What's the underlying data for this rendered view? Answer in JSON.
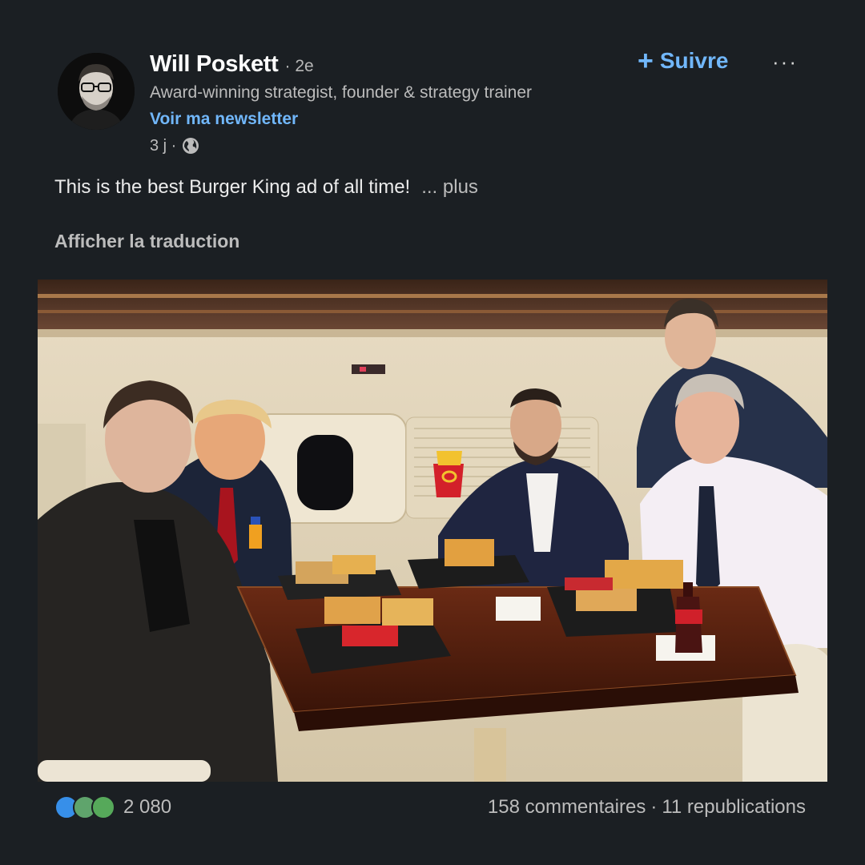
{
  "author": {
    "name": "Will Poskett",
    "degree": "· 2e",
    "headline": "Award-winning strategist, founder & strategy trainer",
    "newsletter_link": "Voir ma newsletter",
    "time": "3 j ·"
  },
  "actions": {
    "follow_label": "Suivre",
    "more_label": "···"
  },
  "post": {
    "text": "This is the best Burger King ad of all time!",
    "more_link": "... plus",
    "translate_label": "Afficher la traduction"
  },
  "engagement": {
    "reaction_count": "2 080",
    "comments": "158 commentaires",
    "separator": "·",
    "reposts": "11 republications"
  },
  "icons": {
    "follow": "plus-icon",
    "visibility": "globe-icon",
    "more": "ellipsis-icon",
    "reactions": [
      "like-icon",
      "celebrate-icon",
      "support-icon"
    ]
  },
  "colors": {
    "background": "#1b1f23",
    "link": "#71b7fb",
    "muted_text": "#bcbcbc"
  }
}
